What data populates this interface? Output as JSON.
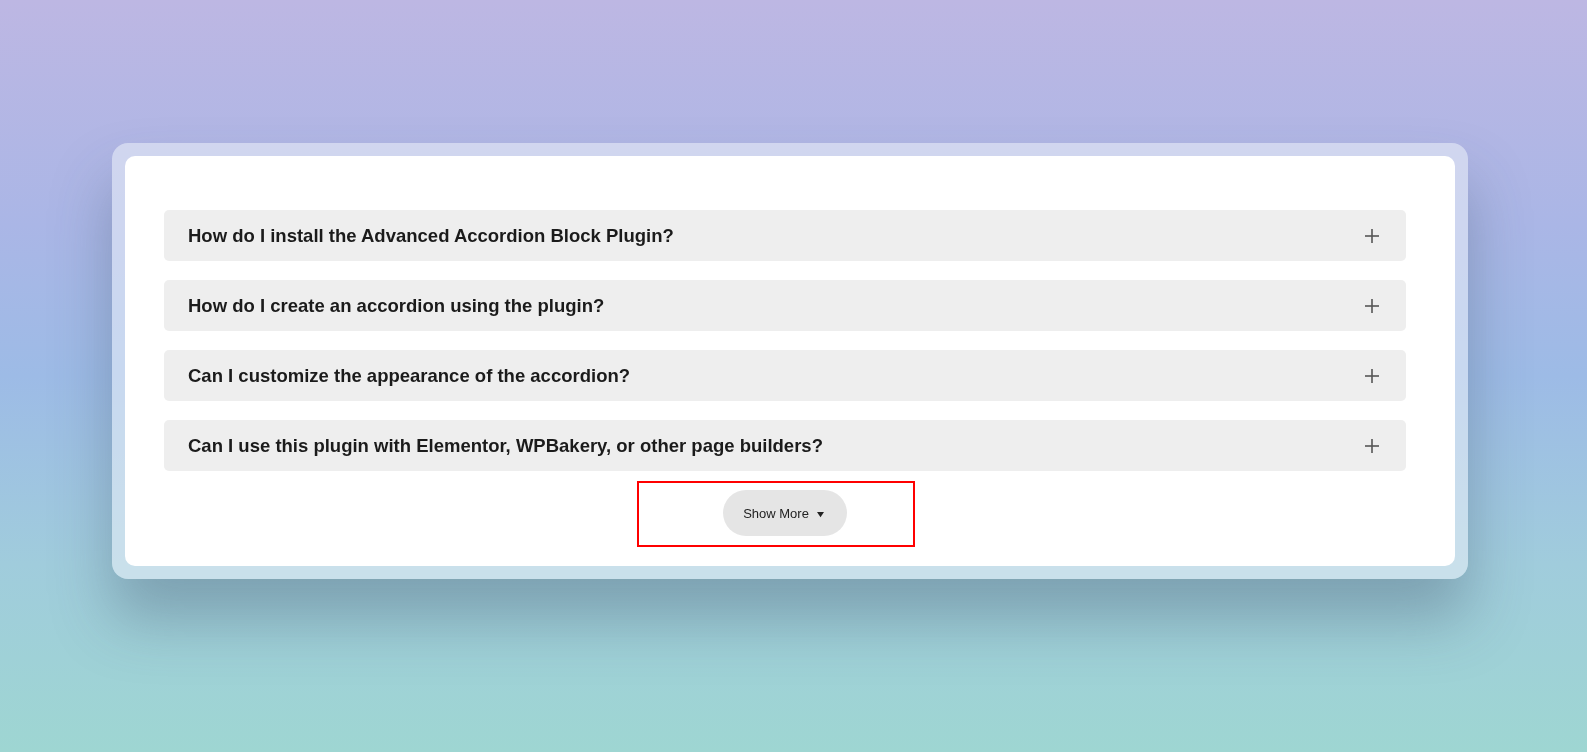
{
  "faq_items": [
    {
      "question": "How do I install the Advanced Accordion Block Plugin?",
      "expanded": false
    },
    {
      "question": "How do I create an accordion using the plugin?",
      "expanded": false
    },
    {
      "question": "Can I customize the appearance of the accordion?",
      "expanded": false
    },
    {
      "question": "Can I use this plugin with Elementor, WPBakery, or other page builders?",
      "expanded": false
    }
  ],
  "show_more": {
    "label": "Show More"
  }
}
